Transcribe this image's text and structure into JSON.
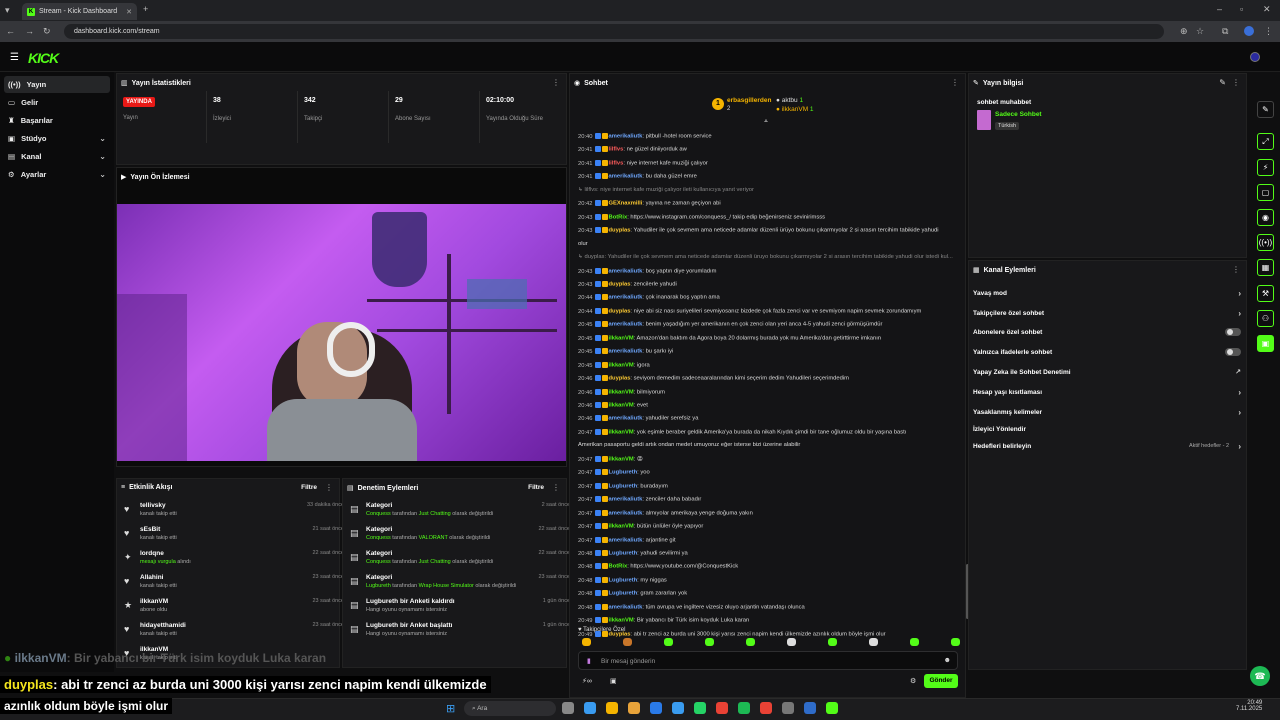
{
  "browser": {
    "tab_title": "Stream - Kick Dashboard",
    "url": "dashboard.kick.com/stream"
  },
  "header": {
    "logo": "KICK"
  },
  "sidebar": {
    "items": [
      {
        "label": "Yayın",
        "icon": "broadcast-icon",
        "active": true
      },
      {
        "label": "Gelir",
        "icon": "revenue-icon"
      },
      {
        "label": "Başarılar",
        "icon": "trophy-icon"
      },
      {
        "label": "Stüdyo",
        "icon": "studio-icon",
        "expandable": true
      },
      {
        "label": "Kanal",
        "icon": "channel-icon",
        "expandable": true
      },
      {
        "label": "Ayarlar",
        "icon": "settings-icon",
        "expandable": true
      }
    ]
  },
  "stats": {
    "title": "Yayın İstatistikleri",
    "live_badge": "YAYINDA",
    "live_label": "Yayın",
    "items": [
      {
        "value": "38",
        "label": "İzleyici"
      },
      {
        "value": "342",
        "label": "Takipçi"
      },
      {
        "value": "29",
        "label": "Abone Sayısı"
      },
      {
        "value": "02:10:00",
        "label": "Yayında Olduğu Süre"
      }
    ]
  },
  "preview": {
    "title": "Yayın Ön İzlemesi"
  },
  "activity": {
    "title": "Etkinlik Akışı",
    "filter": "Filtre",
    "rows": [
      {
        "name": "tellivsky",
        "sub": "kanalı takip etti",
        "time": "33 dakika önce",
        "icon": "heart-icon"
      },
      {
        "name": "sEsBit",
        "sub": "kanalı takip etti",
        "time": "21 saat önce",
        "icon": "heart-icon"
      },
      {
        "name": "lordqne",
        "sub_green": "mesajı vurgula",
        "sub": " alındı",
        "time": "22 saat önce",
        "icon": "highlight-icon"
      },
      {
        "name": "Allahini",
        "sub": "kanalı takip etti",
        "time": "23 saat önce",
        "icon": "heart-icon"
      },
      {
        "name": "ilkkanVM",
        "sub": "abone oldu",
        "time": "23 saat önce",
        "icon": "star-icon"
      },
      {
        "name": "hidayetthamidi",
        "sub": "kanalı takip etti",
        "time": "23 saat önce",
        "icon": "heart-icon"
      },
      {
        "name": "ilkkanVM",
        "sub": "kanalı takip etti",
        "time": "",
        "icon": "heart-icon"
      }
    ]
  },
  "moderation": {
    "title": "Denetim Eylemleri",
    "filter": "Filtre",
    "rows": [
      {
        "name": "Kategori",
        "actor": "Conquess",
        "mid": " tarafından ",
        "target": "Just Chatting",
        "end": " olarak değiştirildi",
        "time": "2 saat önce"
      },
      {
        "name": "Kategori",
        "actor": "Conquess",
        "mid": " tarafından ",
        "target": "VALORANT",
        "end": " olarak değiştirildi",
        "time": "22 saat önce"
      },
      {
        "name": "Kategori",
        "actor": "Conquess",
        "mid": " tarafından ",
        "target": "Just Chatting",
        "end": " olarak değiştirildi",
        "time": "22 saat önce"
      },
      {
        "name": "Kategori",
        "actor": "Lugbureth",
        "mid": " tarafından ",
        "target": "Wrap House Simulator",
        "end": " olarak değiştirildi",
        "time": "23 saat önce"
      },
      {
        "name": "Lugbureth bir Anketi kaldırdı",
        "actor": "",
        "mid": "Hangi oyunu oynamamı istersiniz",
        "target": "",
        "end": "",
        "time": "1 gün önce"
      },
      {
        "name": "Lugbureth bir Anket başlattı",
        "actor": "",
        "mid": "Hangi oyunu oynamamı istersiniz",
        "target": "",
        "end": "",
        "time": "1 gün önce"
      }
    ]
  },
  "chat": {
    "title": "Sohbet",
    "leaderboard": [
      {
        "name": "erbasgillerden",
        "count": "2"
      },
      {
        "name": "aktbu",
        "count": "1"
      },
      {
        "name": "ilkkanVM",
        "count": "1"
      }
    ],
    "messages": [
      {
        "t": "20:40",
        "u": "amerikaliutk",
        "c": "#6fa8ff",
        "m": ": pitbull -hotel room service"
      },
      {
        "t": "20:41",
        "u": "lilflvs",
        "c": "#ff5c5c",
        "m": ": ne güzel diniiyorduk aw"
      },
      {
        "t": "20:41",
        "u": "lilflvs",
        "c": "#ff5c5c",
        "m": ": niye internet kafe muziği çalıyor"
      },
      {
        "t": "20:41",
        "u": "amerikaliutk",
        "c": "#6fa8ff",
        "m": ": bu daha güzel emre"
      },
      {
        "t": "",
        "u": "",
        "c": "#888",
        "m": "↳ lilflvs: niye internet kafe muziği çalıyor ileti kullanıcıya yanıt veriyor"
      },
      {
        "t": "20:42",
        "u": "GEXnaxmilli",
        "c": "#ffcc33",
        "m": ": yayına ne zaman geçiyon abi"
      },
      {
        "t": "20:43",
        "u": "BotRix",
        "c": "#53fc18",
        "m": ": https://www.instagram.com/conquess_/ takip edip beğenirseniz sevinirimsss"
      },
      {
        "t": "20:43",
        "u": "duyplas",
        "c": "#ffcc33",
        "m": ": Yahudiler ile çok sevmem ama neticede adamlar düzenli ürüyo bokunu çıkarmıyolar 2 si arasın tercihim tabikide yahudi"
      },
      {
        "t": "",
        "u": "",
        "c": "#ddd",
        "m": "olur"
      },
      {
        "t": "",
        "u": "",
        "c": "#888",
        "m": "↳ duyplas: Yahudiler ile çok sevmem ama neticede adamlar düzenli üruyo bokunu çıkarmıyolar 2 si arasın tercihim tabikide yahudi olur istedi kul..."
      },
      {
        "t": "20:43",
        "u": "amerikaliutk",
        "c": "#6fa8ff",
        "m": ": boş yaptın diye yorumladım"
      },
      {
        "t": "20:43",
        "u": "duyplas",
        "c": "#ffcc33",
        "m": ": zencilerle yahudi"
      },
      {
        "t": "20:44",
        "u": "amerikaliutk",
        "c": "#6fa8ff",
        "m": ": çok inanarak boş yaptın ama"
      },
      {
        "t": "20:44",
        "u": "duyplas",
        "c": "#ffcc33",
        "m": ": niye abi siz nası suriyelileri sevmiyosanız bizdede çok fazla zenci var ve sevmiyom napim sevmek zorundamıym"
      },
      {
        "t": "20:45",
        "u": "amerikaliutk",
        "c": "#6fa8ff",
        "m": ": benim yaşadığım yer amerikanın en çok zenci olan yeri anca 4-5 yahudi zenci görmüşümdür"
      },
      {
        "t": "20:45",
        "u": "ilkkanVM",
        "c": "#53fc18",
        "m": ": Amazon'dan baktım da Agora boya 20 dolarmış burada yok mu Amerika'dan getirttirme imkanın"
      },
      {
        "t": "20:45",
        "u": "amerikaliutk",
        "c": "#6fa8ff",
        "m": ": bu şarkı iyi"
      },
      {
        "t": "20:45",
        "u": "ilkkanVM",
        "c": "#53fc18",
        "m": ": igora"
      },
      {
        "t": "20:46",
        "u": "duyplas",
        "c": "#ffcc33",
        "m": ": seviyom demedim sadeceaaralarından kimi seçerim dedim Yahudileri seçerimdedim"
      },
      {
        "t": "20:46",
        "u": "ilkkanVM",
        "c": "#53fc18",
        "m": ": bilmiyorum"
      },
      {
        "t": "20:46",
        "u": "ilkkanVM",
        "c": "#53fc18",
        "m": ": evet"
      },
      {
        "t": "20:46",
        "u": "amerikaliutk",
        "c": "#6fa8ff",
        "m": ": yahudiler serefsiz ya"
      },
      {
        "t": "20:47",
        "u": "ilkkanVM",
        "c": "#53fc18",
        "m": ": yok eşimle beraber geldik Amerika'ya burada da nikah Kıydık şimdi bir tane oğlumuz oldu bir yaşına bastı"
      },
      {
        "t": "",
        "u": "",
        "c": "#ddd",
        "m": "Amerikan pasaportu geldi artık ondan medet umuyoruz eğer isterse bizi üzerine alabilir"
      },
      {
        "t": "20:47",
        "u": "ilkkanVM",
        "c": "#53fc18",
        "m": ": 😡"
      },
      {
        "t": "20:47",
        "u": "Lugbureth",
        "c": "#6fa8ff",
        "m": ": yoo"
      },
      {
        "t": "20:47",
        "u": "Lugbureth",
        "c": "#6fa8ff",
        "m": ": buradayım"
      },
      {
        "t": "20:47",
        "u": "amerikaliutk",
        "c": "#6fa8ff",
        "m": ": zenciler daha babadır"
      },
      {
        "t": "20:47",
        "u": "amerikaliutk",
        "c": "#6fa8ff",
        "m": ": almıyolar amerikaya yenge doğuma yakın"
      },
      {
        "t": "20:47",
        "u": "ilkkanVM",
        "c": "#53fc18",
        "m": ": bütün ünlüler öyle yapıyor"
      },
      {
        "t": "20:47",
        "u": "amerikaliutk",
        "c": "#6fa8ff",
        "m": ": arjantine git"
      },
      {
        "t": "20:48",
        "u": "Lugbureth",
        "c": "#6fa8ff",
        "m": ": yahudi sevilirmi ya"
      },
      {
        "t": "20:48",
        "u": "BotRix",
        "c": "#53fc18",
        "m": ": https://www.youtube.com/@ConquestKick"
      },
      {
        "t": "20:48",
        "u": "Lugbureth",
        "c": "#6fa8ff",
        "m": ": my niggas"
      },
      {
        "t": "20:48",
        "u": "Lugbureth",
        "c": "#6fa8ff",
        "m": ": gram zararları yok"
      },
      {
        "t": "20:48",
        "u": "amerikaliutk",
        "c": "#6fa8ff",
        "m": ": tüm avrupa ve ingiltere vizesiz oluyo arjantin vatandaşı olunca"
      },
      {
        "t": "20:49",
        "u": "ilkkanVM",
        "c": "#53fc18",
        "m": ": Bir yabancı bir Türk isim koyduk Luka karan"
      },
      {
        "t": "20:49",
        "u": "duyplas",
        "c": "#ffcc33",
        "m": ": abi tr zenci az burda uni 3000 kişi yarısı zenci napim kendi ülkemizde azınlık oldum böyle işmi olur"
      }
    ],
    "followers_only": "Takipçilere Özel",
    "input_placeholder": "Bir mesaj gönderin",
    "send": "Gönder"
  },
  "stream_info": {
    "title": "Yayın bilgisi",
    "stream_title": "sohbet muhabbet",
    "category": "Sadece Sohbet",
    "language": "Türkish"
  },
  "channel_actions": {
    "title": "Kanal Eylemleri",
    "items": [
      {
        "label": "Yavaş mod",
        "type": "chevron"
      },
      {
        "label": "Takipçilere özel sohbet",
        "type": "chevron"
      },
      {
        "label": "Abonelere özel sohbet",
        "type": "toggle"
      },
      {
        "label": "Yalnızca ifadelerle sohbet",
        "type": "toggle"
      },
      {
        "label": "Yapay Zeka ile Sohbet Denetimi",
        "type": "external"
      },
      {
        "label": "Hesap yaşı kısıtlaması",
        "type": "chevron"
      },
      {
        "label": "Yasaklanmış kelimeler",
        "type": "chevron"
      },
      {
        "label": "İzleyici Yönlendir",
        "type": "none"
      },
      {
        "label": "Hedefleri belirleyin",
        "type": "chevron",
        "extra": "Aktif hedefler - 2"
      }
    ]
  },
  "overlay": {
    "line1_user": "ilkkanVM",
    "line1_msg": ": Bir yabancı bir Türk isim koyduk Luka karan",
    "line2_user": "duyplas",
    "line2_msg": ": abi tr zenci az burda uni 3000 kişi yarısı zenci napim kendi ülkemizde",
    "line3": "azınlık oldum böyle işmi olur"
  },
  "taskbar": {
    "search": "Ara",
    "time": "20:49",
    "date": "7.11.2025"
  },
  "colors": {
    "accent": "#53fc18",
    "live": "#e91916",
    "bg": "#0f0f10",
    "panel": "#18181a"
  }
}
